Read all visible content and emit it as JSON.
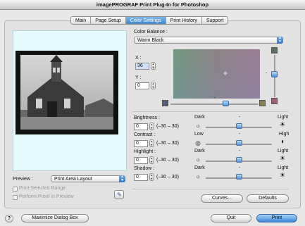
{
  "window": {
    "title": "imagePROGRAF Print Plug-In for Photoshop"
  },
  "tabs": [
    {
      "label": "Main",
      "active": false
    },
    {
      "label": "Page Setup",
      "active": false
    },
    {
      "label": "Color Settings",
      "active": true
    },
    {
      "label": "Print History",
      "active": false
    },
    {
      "label": "Support",
      "active": false
    }
  ],
  "color_balance": {
    "label": "Color Balance :",
    "selected": "Warm Black",
    "x_label": "X :",
    "x_value": "36",
    "y_label": "Y :",
    "y_value": "0",
    "x_position": 0.7,
    "y_position": 0.5,
    "colors": {
      "top_right": "#5a7060",
      "right_bottom": "#a06070",
      "bottom_left": "#50607a",
      "bottom_right": "#8a8050"
    }
  },
  "adjustments": {
    "brightness": {
      "label": "Brightness :",
      "value": "0",
      "range": "(–30 – 30)",
      "left_label": "Dark",
      "center_label": "-",
      "right_label": "Light",
      "left_icon": "sun-dim-icon",
      "right_icon": "sun-bright-icon",
      "level": 0.5
    },
    "contrast": {
      "label": "Contrast :",
      "value": "0",
      "range": "(–30 – 30)",
      "left_label": "Low",
      "center_label": "-",
      "right_label": "High",
      "left_icon": "contrast-low-icon",
      "right_icon": "contrast-high-icon",
      "level": 0.5
    },
    "highlight": {
      "label": "Highlight :",
      "value": "0",
      "range": "(–30 – 30)",
      "left_label": "Dark",
      "center_label": "-",
      "right_label": "Light",
      "left_icon": "sun-dim-icon",
      "right_icon": "sun-bright-icon",
      "level": 0.5
    },
    "shadow": {
      "label": "Shadow :",
      "value": "0",
      "range": "(–30 – 30)",
      "left_label": "Dark",
      "center_label": "-",
      "right_label": "Light",
      "left_icon": "sun-dim-icon",
      "right_icon": "sun-bright-icon",
      "level": 0.5
    }
  },
  "preview": {
    "label": "Preview :",
    "selected": "Print Area Layout",
    "print_selected_range": "Print Selected Range",
    "perform_proof": "Perform Proof in Preview"
  },
  "buttons": {
    "curves": "Curves...",
    "defaults": "Defaults",
    "maximize": "Maximize Dialog Box",
    "quit": "Quit",
    "print": "Print",
    "help": "?"
  },
  "accent": "#3f86cf"
}
